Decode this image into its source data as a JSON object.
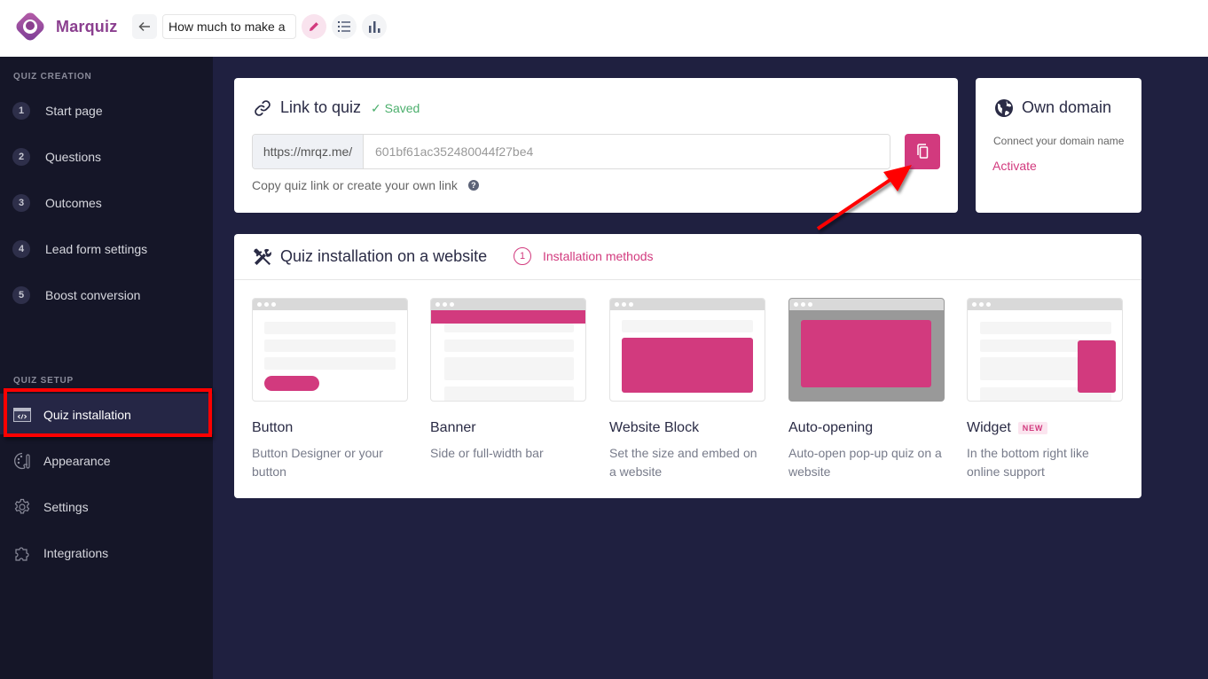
{
  "header": {
    "brand": "Marquiz",
    "quiz_title": "How much to make a",
    "back_icon": "arrow-left-icon",
    "edit_icon": "pencil-icon",
    "list_icon": "list-icon",
    "stats_icon": "bar-chart-icon"
  },
  "sidebar": {
    "creation_label": "QUIZ CREATION",
    "steps": [
      {
        "num": "1",
        "label": "Start page"
      },
      {
        "num": "2",
        "label": "Questions"
      },
      {
        "num": "3",
        "label": "Outcomes"
      },
      {
        "num": "4",
        "label": "Lead form settings"
      },
      {
        "num": "5",
        "label": "Boost conversion"
      }
    ],
    "setup_label": "QUIZ SETUP",
    "setup_items": [
      {
        "label": "Quiz installation",
        "icon": "code-window-icon",
        "active": true
      },
      {
        "label": "Appearance",
        "icon": "palette-icon"
      },
      {
        "label": "Settings",
        "icon": "gear-icon"
      },
      {
        "label": "Integrations",
        "icon": "puzzle-icon"
      }
    ]
  },
  "link_card": {
    "title": "Link to quiz",
    "status": "✓ Saved",
    "url_prefix": "https://mrqz.me/",
    "url_slug": "601bf61ac352480044f27be4",
    "hint": "Copy quiz link or create your own link",
    "help": "?"
  },
  "domain_card": {
    "title": "Own domain",
    "subtitle": "Connect your domain name",
    "action": "Activate"
  },
  "install_card": {
    "title": "Quiz installation on a website",
    "tab_num": "1",
    "tab_label": "Installation methods",
    "methods": [
      {
        "title": "Button",
        "desc": "Button Designer or your button"
      },
      {
        "title": "Banner",
        "desc": "Side or full-width bar"
      },
      {
        "title": "Website Block",
        "desc": "Set the size and embed on a website"
      },
      {
        "title": "Auto-opening",
        "desc": "Auto-open pop-up quiz on a website"
      },
      {
        "title": "Widget",
        "desc": "In the bottom right like online support",
        "badge": "NEW"
      }
    ]
  },
  "colors": {
    "accent": "#d23a7e",
    "sidebar_bg": "#151628",
    "main_bg": "#1f2040",
    "saved_green": "#4caf6d",
    "annotation_red": "#ff0000"
  }
}
